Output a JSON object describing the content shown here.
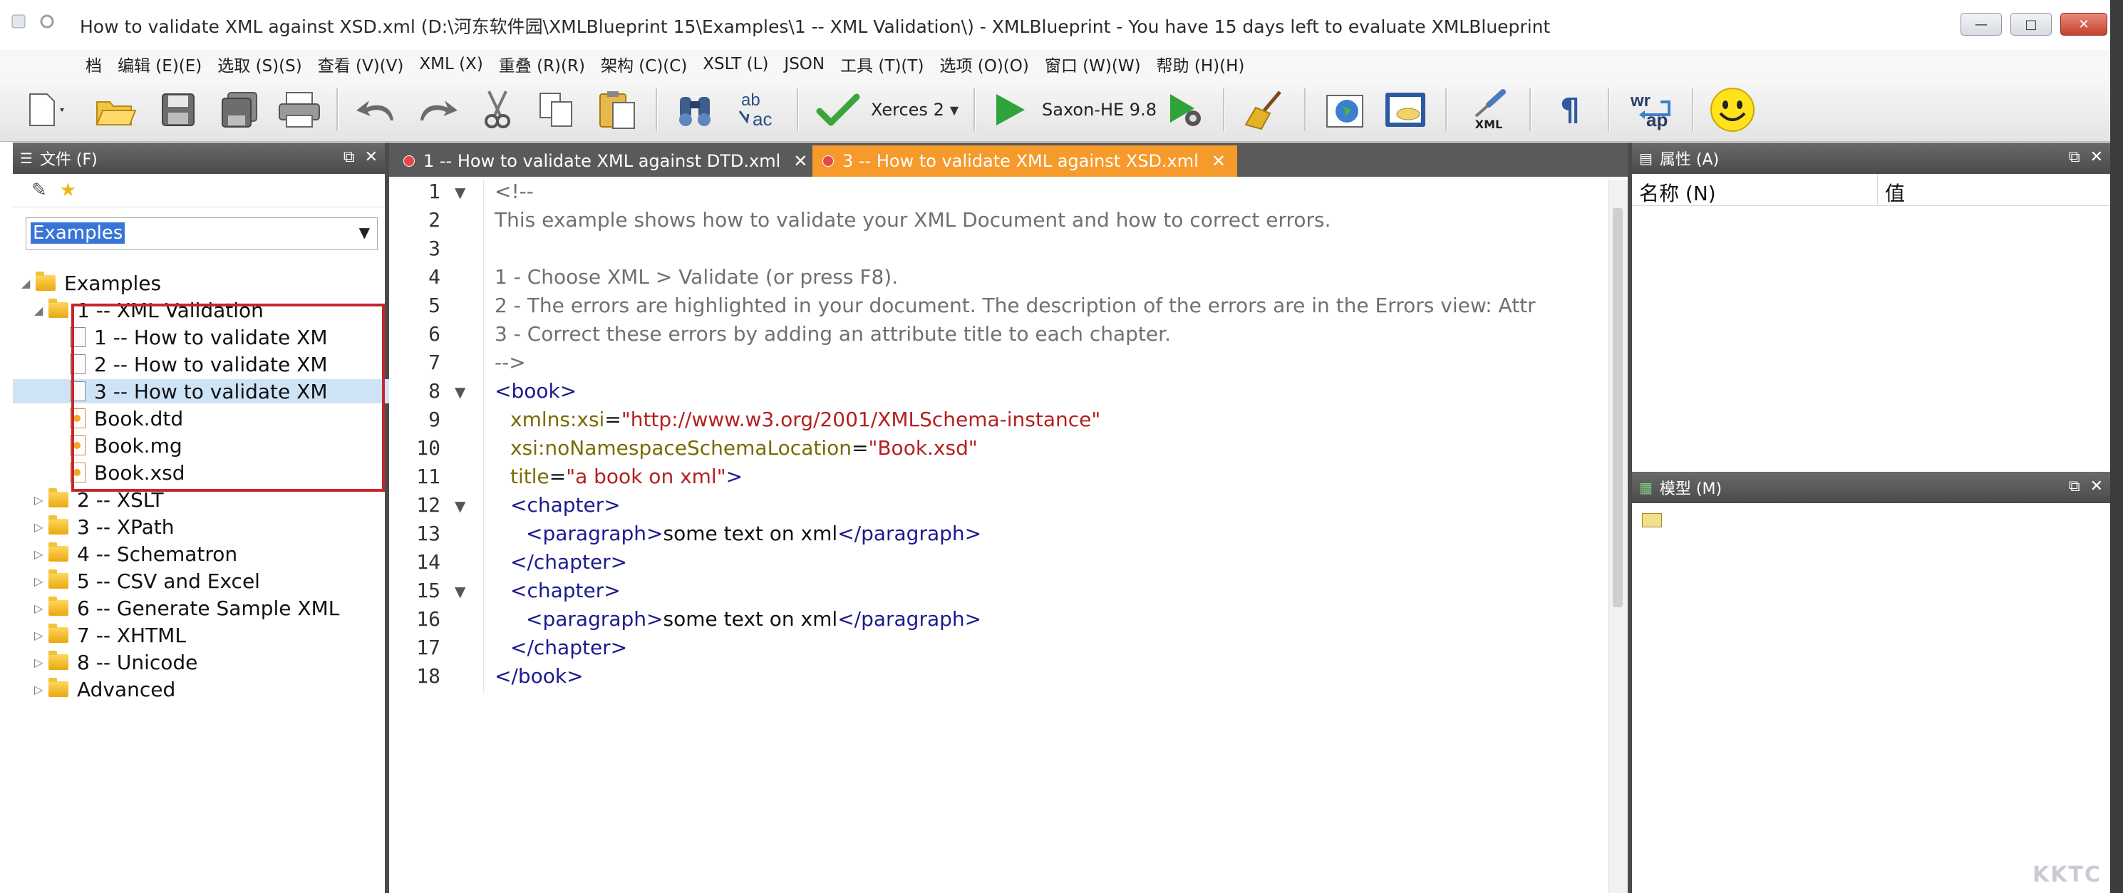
{
  "window": {
    "title": "How to validate XML against XSD.xml  (D:\\河东软件园\\XMLBlueprint 15\\Examples\\1 -- XML Validation\\) - XMLBlueprint - You have 15 days left to evaluate XMLBlueprint",
    "minimize_glyph": "—",
    "maximize_glyph": "□",
    "close_glyph": "✕"
  },
  "menu": [
    "档",
    "编辑 (E)(E)",
    "选取 (S)(S)",
    "查看 (V)(V)",
    "XML (X)",
    "重叠 (R)(R)",
    "架构 (C)(C)",
    "XSLT (L)",
    "JSON",
    "工具 (T)(T)",
    "选项 (O)(O)",
    "窗口 (W)(W)",
    "帮助 (H)(H)"
  ],
  "toolbar": {
    "validator_label": "Xerces 2",
    "transform_label": "Saxon-HE 9.8",
    "xml_badge": "XML",
    "wrap_top": "wr",
    "wrap_bottom": "ap",
    "pilcrow": "¶",
    "abc_top": "ab",
    "abc_bottom": "ac"
  },
  "left_panel": {
    "title": "文件 (F)",
    "combo_value": "Examples",
    "tree": [
      {
        "label": "Examples",
        "kind": "folder",
        "level": 0,
        "expanded": true
      },
      {
        "label": "1 -- XML Validation",
        "kind": "folder",
        "level": 1,
        "expanded": true
      },
      {
        "label": "1 -- How to validate XM",
        "kind": "file",
        "level": 2
      },
      {
        "label": "2 -- How to validate XM",
        "kind": "file",
        "level": 2
      },
      {
        "label": "3 -- How to validate XM",
        "kind": "file",
        "level": 2,
        "selected": true
      },
      {
        "label": "Book.dtd",
        "kind": "file-dtd",
        "level": 2
      },
      {
        "label": "Book.mg",
        "kind": "file-dtd",
        "level": 2
      },
      {
        "label": "Book.xsd",
        "kind": "file-dtd",
        "level": 2
      },
      {
        "label": "2 -- XSLT",
        "kind": "folder",
        "level": 1
      },
      {
        "label": "3 -- XPath",
        "kind": "folder",
        "level": 1
      },
      {
        "label": "4 -- Schematron",
        "kind": "folder",
        "level": 1
      },
      {
        "label": "5 -- CSV and Excel",
        "kind": "folder",
        "level": 1
      },
      {
        "label": "6 -- Generate Sample XML",
        "kind": "folder",
        "level": 1
      },
      {
        "label": "7 -- XHTML",
        "kind": "folder",
        "level": 1
      },
      {
        "label": "8 -- Unicode",
        "kind": "folder",
        "level": 1
      },
      {
        "label": "Advanced",
        "kind": "folder",
        "level": 1
      }
    ]
  },
  "tabs": [
    {
      "label": "1 -- How to validate XML against DTD.xml",
      "active": false
    },
    {
      "label": "3 -- How to validate XML against XSD.xml",
      "active": true
    }
  ],
  "editor": {
    "line_numbers": [
      "1",
      "2",
      "3",
      "4",
      "5",
      "6",
      "7",
      "8",
      "9",
      "10",
      "11",
      "12",
      "13",
      "14",
      "15",
      "16",
      "17",
      "18"
    ],
    "lines": [
      "<!--",
      "This example shows how to validate your XML Document and how to correct errors.",
      "",
      "1 - Choose XML > Validate (or press F8).",
      "2 - The errors are highlighted in your document. The description of the errors are in the Errors view: Attr",
      "3 - Correct these errors by adding an attribute title to each chapter.",
      "-->",
      "<book>",
      "xmlns:xsi=\"http://www.w3.org/2001/XMLSchema-instance\"",
      "xsi:noNamespaceSchemaLocation=\"Book.xsd\"",
      "title=\"a book on xml\">",
      "<chapter>",
      "<paragraph>some text on xml</paragraph>",
      "</chapter>",
      "<chapter>",
      "<paragraph>some text on xml</paragraph>",
      "</chapter>",
      "</book>"
    ]
  },
  "right_panel": {
    "properties_title": "属性 (A)",
    "col_name": "名称 (N)",
    "col_value": "值",
    "model_title": "模型 (M)"
  },
  "watermark": "KKTC"
}
